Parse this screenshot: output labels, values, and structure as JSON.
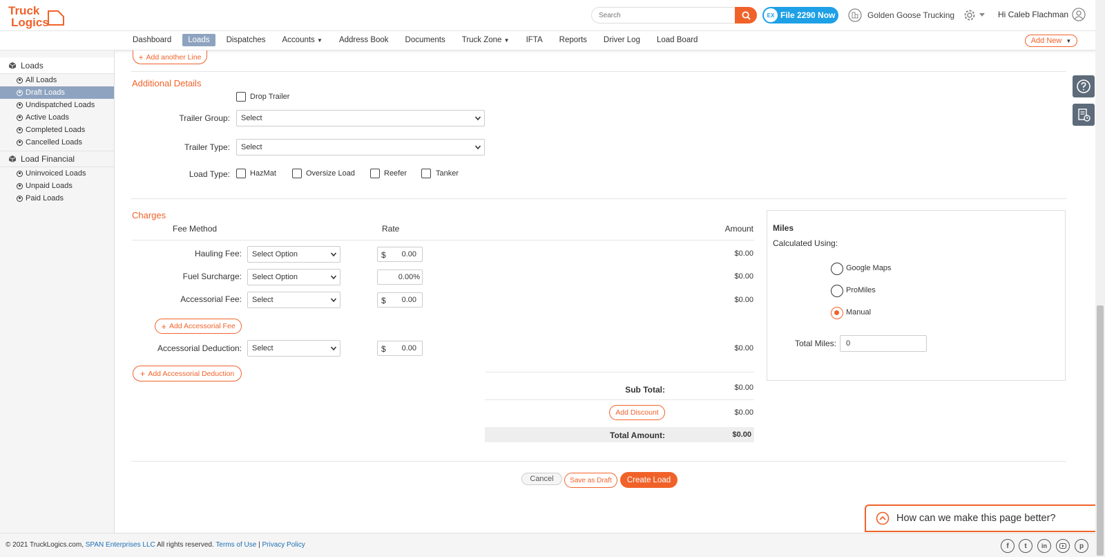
{
  "header": {
    "logo_text": "TruckLogics",
    "search_placeholder": "Search",
    "file2290_label": "File 2290 Now",
    "company_name": "Golden Goose Trucking",
    "greeting": "Hi Caleb Flachman"
  },
  "nav": {
    "items": [
      "Dashboard",
      "Loads",
      "Dispatches",
      "Accounts",
      "Address Book",
      "Documents",
      "Truck Zone",
      "IFTA",
      "Reports",
      "Driver Log",
      "Load Board"
    ],
    "active": "Loads",
    "add_new_label": "Add New"
  },
  "sidebar": {
    "loads_heading": "Loads",
    "loads_items": [
      "All Loads",
      "Draft Loads",
      "Undispatched Loads",
      "Active Loads",
      "Completed Loads",
      "Cancelled Loads"
    ],
    "active_item": "Draft Loads",
    "financial_heading": "Load Financial",
    "financial_items": [
      "Uninvoiced Loads",
      "Unpaid Loads",
      "Paid Loads"
    ]
  },
  "form": {
    "add_line_label": "Add another Line",
    "additional_details_title": "Additional Details",
    "drop_trailer_label": "Drop Trailer",
    "trailer_group_label": "Trailer Group:",
    "trailer_group_value": "Select",
    "trailer_type_label": "Trailer Type:",
    "trailer_type_value": "Select",
    "load_type_label": "Load Type:",
    "load_types": [
      "HazMat",
      "Oversize Load",
      "Reefer",
      "Tanker"
    ]
  },
  "charges": {
    "title": "Charges",
    "col_fee_method": "Fee Method",
    "col_rate": "Rate",
    "col_amount": "Amount",
    "hauling_label": "Hauling Fee:",
    "hauling_method": "Select Option",
    "hauling_currency": "$",
    "hauling_rate": "0.00",
    "hauling_amount": "$0.00",
    "fuel_label": "Fuel Surcharge:",
    "fuel_method": "Select Option",
    "fuel_rate": "0.00%",
    "fuel_amount": "$0.00",
    "accessorial_label": "Accessorial Fee:",
    "accessorial_method": "Select",
    "accessorial_currency": "$",
    "accessorial_rate": "0.00",
    "accessorial_amount": "$0.00",
    "add_accessorial_fee": "Add Accessorial Fee",
    "deduction_label": "Accessorial Deduction:",
    "deduction_method": "Select",
    "deduction_currency": "$",
    "deduction_rate": "0.00",
    "deduction_amount": "$0.00",
    "add_accessorial_deduction": "Add Accessorial Deduction",
    "subtotal_label": "Sub Total:",
    "subtotal_value": "$0.00",
    "add_discount_label": "Add Discount",
    "discount_value": "$0.00",
    "total_label": "Total Amount:",
    "total_value": "$0.00"
  },
  "miles": {
    "title": "Miles",
    "calculated_label": "Calculated Using:",
    "options": [
      "Google Maps",
      "ProMiles",
      "Manual"
    ],
    "selected": "Manual",
    "total_miles_label": "Total Miles:",
    "total_miles_value": "0"
  },
  "actions": {
    "cancel": "Cancel",
    "save_draft": "Save as Draft",
    "create": "Create Load"
  },
  "feedback": {
    "label": "How can we make this page better?"
  },
  "footer": {
    "copyright": "© 2021 TruckLogics.com,",
    "company_link": "SPAN Enterprises LLC",
    "rights": "All rights reserved.",
    "terms": "Terms of Use",
    "separator": "|",
    "privacy": "Privacy Policy"
  },
  "colors": {
    "accent": "#f0622a",
    "nav_active": "#8ea3bf",
    "file2290": "#1ea0e6"
  }
}
